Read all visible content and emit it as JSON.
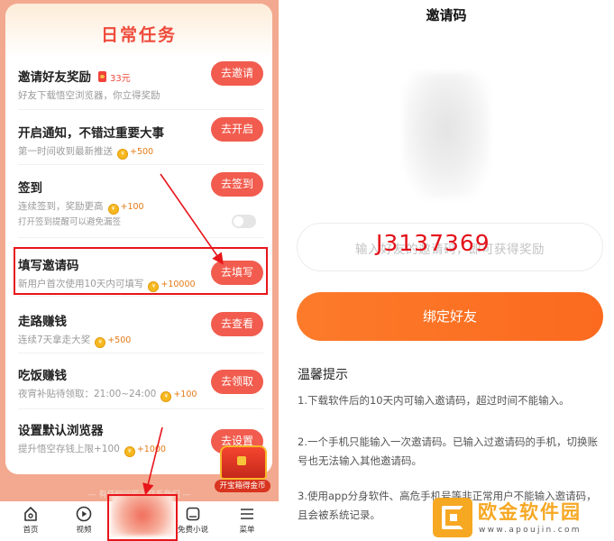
{
  "colors": {
    "accent": "#f15c4e",
    "primary_button": "#fb6a1f",
    "highlight": "#e8151b",
    "panel_bg": "#f2a98f"
  },
  "tasks_panel": {
    "title": "日常任务",
    "items": [
      {
        "title": "邀请好友奖励",
        "reward": "33元",
        "desc": "好友下载悟空浏览器，你立得奖励",
        "button": "去邀请"
      },
      {
        "title": "开启通知，不错过重要大事",
        "reward": "+500",
        "desc": "第一时间收到最新推送",
        "button": "去开启"
      },
      {
        "title": "签到",
        "reward": "+100",
        "desc": "连续签到，奖励更高",
        "button": "去签到"
      },
      {
        "title": "填写邀请码",
        "reward": "+10000",
        "desc": "新用户首次使用10天内可填写",
        "button": "去填写"
      },
      {
        "title": "走路赚钱",
        "reward": "+500",
        "desc": "连续7天拿走大奖",
        "button": "去查看"
      },
      {
        "title": "吃饭赚钱",
        "reward": "+100",
        "desc": "夜宵补贴待领取：21:00~24:00",
        "button": "去领取"
      },
      {
        "title": "设置默认浏览器",
        "reward": "+1000",
        "desc": "提升悟空存钱上限+100",
        "button": "去设置"
      }
    ],
    "signin_reminder": "打开签到提醒可以避免漏签",
    "footer_note": "— 有任何问题可联系我们 —",
    "treasure_label": "开宝箱得金币"
  },
  "tabbar": {
    "items": [
      {
        "label": "首页",
        "icon": "home-icon"
      },
      {
        "label": "视频",
        "icon": "video-icon"
      },
      {
        "label": "免费小说",
        "icon": "book-icon"
      },
      {
        "label": "菜单",
        "icon": "menu-icon"
      }
    ]
  },
  "invite_page": {
    "title": "邀请码",
    "input_placeholder": "输入好友的邀请码，即可获得奖励",
    "code_annotation": "J3137369",
    "bind_button": "绑定好友",
    "tips_title": "温馨提示",
    "tips": [
      "1.下载软件后的10天内可输入邀请码，超过时间不能输入。",
      "2.一个手机只能输入一次邀请码。已输入过邀请码的手机，切换账号也无法输入其他邀请码。",
      "3.使用app分身软件、高危手机号等非正常用户不能输入邀请码，且会被系统记录。"
    ]
  },
  "watermark": {
    "name": "欧金软件园",
    "url": "www.apoujin.com"
  }
}
